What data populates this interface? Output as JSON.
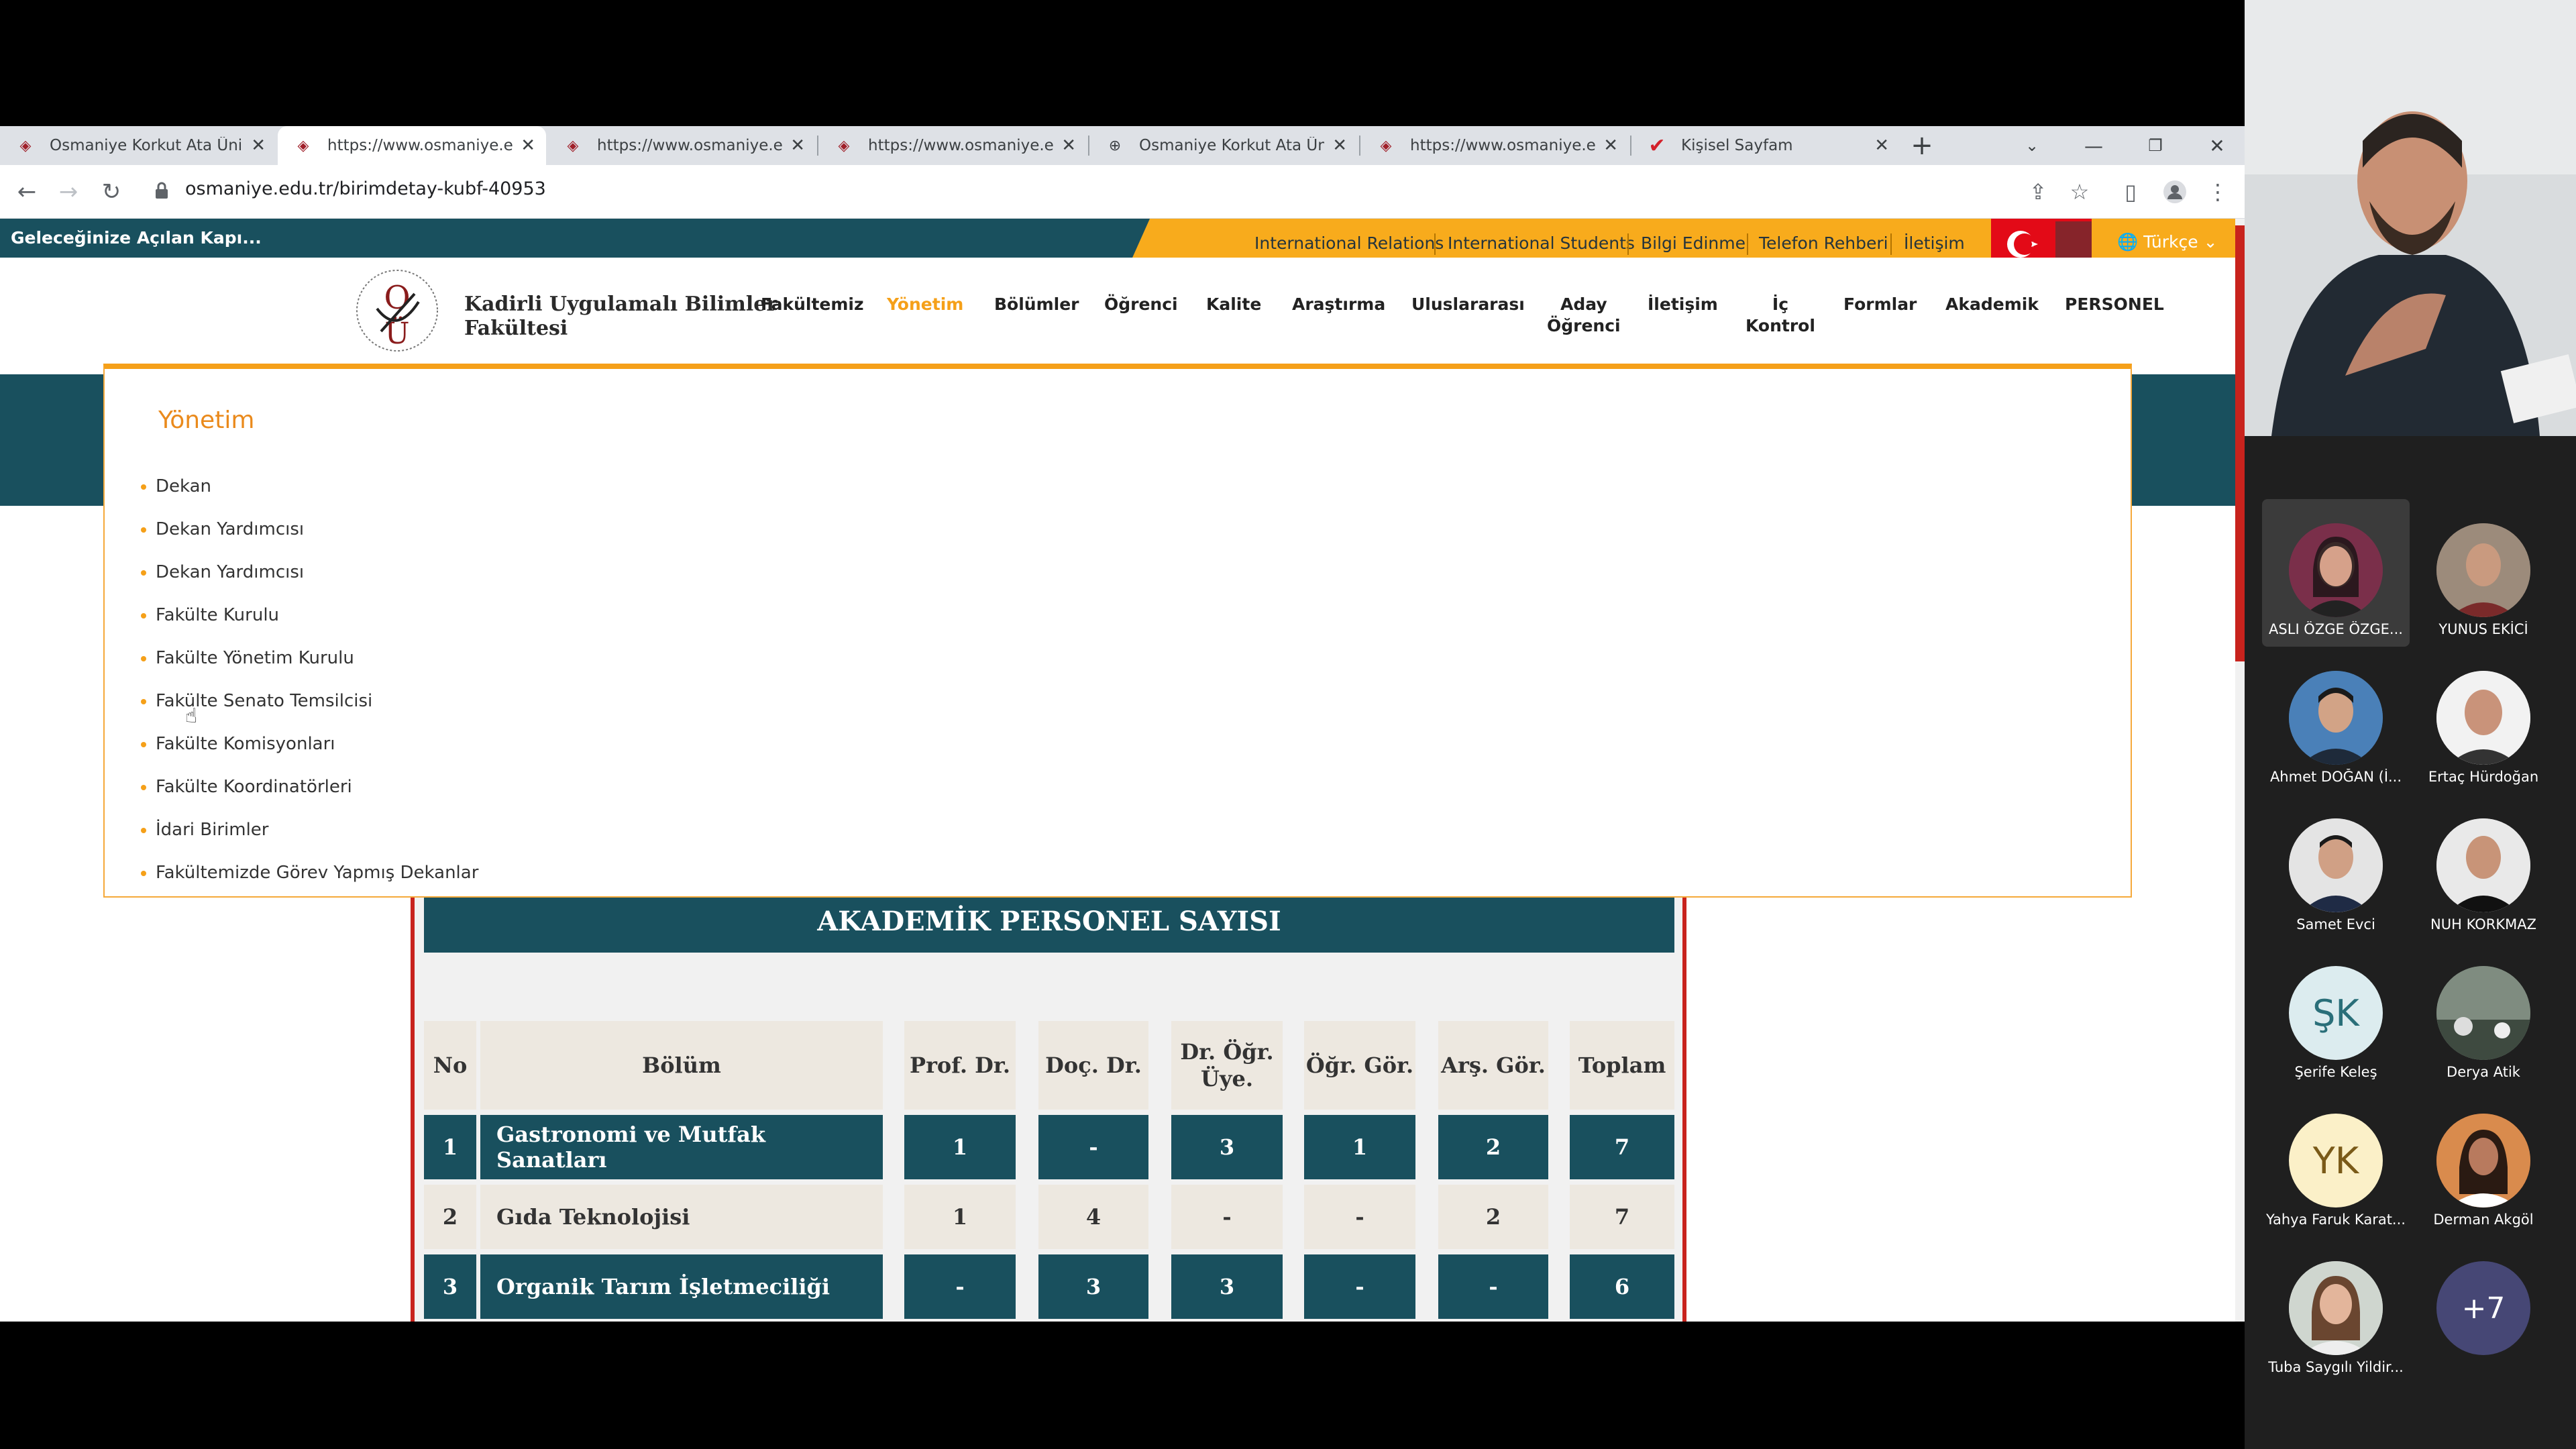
{
  "browser": {
    "tabs": [
      {
        "title": "Osmaniye Korkut Ata Üniv",
        "icon": "university-favicon"
      },
      {
        "title": "https://www.osmaniye.edu",
        "icon": "university-favicon"
      },
      {
        "title": "https://www.osmaniye.edu",
        "icon": "university-favicon"
      },
      {
        "title": "https://www.osmaniye.edu",
        "icon": "university-favicon"
      },
      {
        "title": "Osmaniye Korkut Ata Üniv",
        "icon": "globe-favicon"
      },
      {
        "title": "https://www.osmaniye.edu",
        "icon": "university-favicon"
      },
      {
        "title": "Kişisel Sayfam",
        "icon": "checkmark-favicon"
      }
    ],
    "url": "osmaniye.edu.tr/birimdetay-kubf-40953"
  },
  "site": {
    "slogan": "Geleceğinize Açılan Kapı...",
    "top_links": [
      "International Relations",
      "International Students",
      "Bilgi Edinme",
      "Telefon Rehberi",
      "İletişim"
    ],
    "language": "Türkçe",
    "faculty_name_line1": "Kadirli Uygulamalı Bilimler",
    "faculty_name_line2": "Fakültesi",
    "menu": [
      {
        "line1": "Fakültemiz",
        "line2": ""
      },
      {
        "line1": "Yönetim",
        "line2": ""
      },
      {
        "line1": "Bölümler",
        "line2": ""
      },
      {
        "line1": "Öğrenci",
        "line2": ""
      },
      {
        "line1": "Kalite",
        "line2": ""
      },
      {
        "line1": "Araştırma",
        "line2": ""
      },
      {
        "line1": "Uluslararası",
        "line2": ""
      },
      {
        "line1": "Aday",
        "line2": "Öğrenci"
      },
      {
        "line1": "İletişim",
        "line2": ""
      },
      {
        "line1": "İç",
        "line2": "Kontrol"
      },
      {
        "line1": "Formlar",
        "line2": ""
      },
      {
        "line1": "Akademik",
        "line2": ""
      },
      {
        "line1": "PERSONEL",
        "line2": ""
      }
    ],
    "active_menu": "Yönetim",
    "accent_color": "#f5a019",
    "teal_color": "#19505e"
  },
  "dropdown": {
    "title": "Yönetim",
    "items": [
      "Dekan",
      "Dekan Yardımcısı",
      "Dekan Yardımcısı",
      "Fakülte Kurulu",
      "Fakülte Yönetim Kurulu",
      "Fakülte Senato Temsilcisi",
      "Fakülte Komisyonları",
      "Fakülte Koordinatörleri",
      "İdari Birimler",
      "Fakültemizde Görev Yapmış Dekanlar"
    ]
  },
  "staff_table": {
    "title": "AKADEMİK PERSONEL SAYISI",
    "headers": [
      "No",
      "Bölüm",
      "Prof. Dr.",
      "Doç. Dr.",
      "Dr. Öğr. Üye.",
      "Öğr. Gör.",
      "Arş. Gör.",
      "Toplam"
    ],
    "rows": [
      [
        "1",
        "Gastronomi ve Mutfak Sanatları",
        "1",
        "-",
        "3",
        "1",
        "2",
        "7"
      ],
      [
        "2",
        "Gıda Teknolojisi",
        "1",
        "4",
        "-",
        "-",
        "2",
        "7"
      ],
      [
        "3",
        "Organik Tarım İşletmeciliği",
        "-",
        "3",
        "3",
        "-",
        "-",
        "6"
      ]
    ]
  },
  "meeting": {
    "participants": [
      {
        "name": "ASLI ÖZGE ÖZGE...",
        "initials": "",
        "avatar": "photo"
      },
      {
        "name": "YUNUS EKİCİ",
        "initials": "",
        "avatar": "photo"
      },
      {
        "name": "Ahmet DOĞAN (İ...",
        "initials": "",
        "avatar": "photo"
      },
      {
        "name": "Ertaç Hürdoğan",
        "initials": "",
        "avatar": "photo"
      },
      {
        "name": "Samet Evci",
        "initials": "",
        "avatar": "photo"
      },
      {
        "name": "NUH KORKMAZ",
        "initials": "",
        "avatar": "photo"
      },
      {
        "name": "Şerife Keleş",
        "initials": "ŞK",
        "avatar": "initials"
      },
      {
        "name": "Derya Atik",
        "initials": "",
        "avatar": "photo"
      },
      {
        "name": "Yahya Faruk Karat...",
        "initials": "YK",
        "avatar": "initials"
      },
      {
        "name": "Derman Akgöl",
        "initials": "",
        "avatar": "photo"
      },
      {
        "name": "Tuba Saygılı Yildir...",
        "initials": "",
        "avatar": "photo"
      }
    ],
    "more_count": "+7"
  }
}
